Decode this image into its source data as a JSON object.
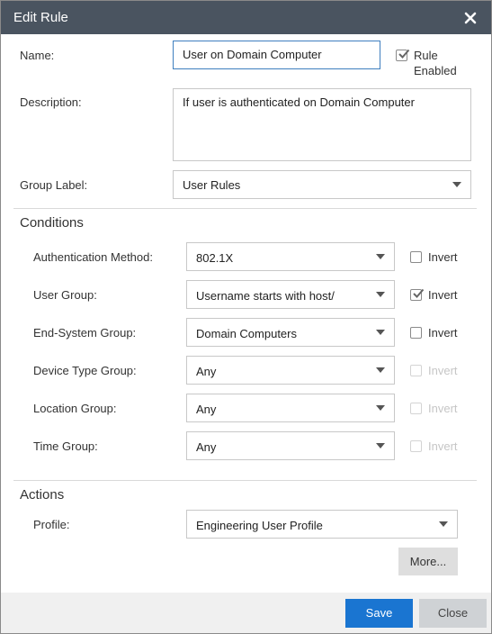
{
  "dialog": {
    "title": "Edit Rule",
    "close_icon": "close-icon"
  },
  "form": {
    "name_label": "Name:",
    "name_value": "User on Domain Computer",
    "rule_enabled_label_1": "Rule",
    "rule_enabled_label_2": "Enabled",
    "rule_enabled": true,
    "description_label": "Description:",
    "description_value": "If user is authenticated on Domain Computer",
    "group_label_label": "Group Label:",
    "group_label_value": "User Rules"
  },
  "conditions": {
    "heading": "Conditions",
    "invert_label": "Invert",
    "rows": [
      {
        "label": "Authentication Method:",
        "value": "802.1X",
        "invert": false,
        "invert_enabled": true
      },
      {
        "label": "User Group:",
        "value": "Username starts with host/",
        "invert": true,
        "invert_enabled": true
      },
      {
        "label": "End-System Group:",
        "value": "Domain Computers",
        "invert": false,
        "invert_enabled": true
      },
      {
        "label": "Device Type Group:",
        "value": "Any",
        "invert": false,
        "invert_enabled": false
      },
      {
        "label": "Location Group:",
        "value": "Any",
        "invert": false,
        "invert_enabled": false
      },
      {
        "label": "Time Group:",
        "value": "Any",
        "invert": false,
        "invert_enabled": false
      }
    ]
  },
  "actions": {
    "heading": "Actions",
    "profile_label": "Profile:",
    "profile_value": "Engineering User Profile",
    "more_label": "More..."
  },
  "footer": {
    "save_label": "Save",
    "close_label": "Close"
  },
  "colors": {
    "titlebar": "#4a5460",
    "primary": "#1a75d1",
    "focus_border": "#3f7fbf"
  }
}
